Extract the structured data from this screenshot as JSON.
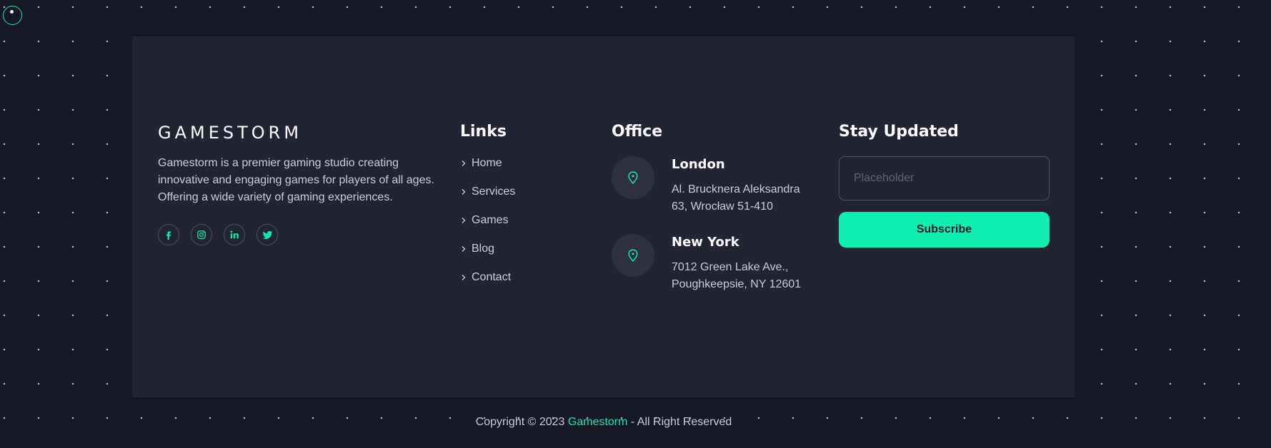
{
  "colors": {
    "page_background": "#161828",
    "panel_background": "#222433",
    "accent": "#10eeb3",
    "heading_text": "#ffffff",
    "body_text": "#c9ccd6"
  },
  "brand": {
    "logo": "GAMESTORM",
    "description": "Gamestorm is a premier gaming studio creating innovative and engaging games for players of all ages. Offering a wide variety of gaming experiences.",
    "socials": [
      {
        "icon": "facebook-icon"
      },
      {
        "icon": "instagram-icon"
      },
      {
        "icon": "linkedin-icon"
      },
      {
        "icon": "twitter-icon"
      }
    ]
  },
  "links": {
    "heading": "Links",
    "items": [
      {
        "label": "Home",
        "icon": "chevron-right-icon"
      },
      {
        "label": "Services",
        "icon": "chevron-right-icon"
      },
      {
        "label": "Games",
        "icon": "chevron-right-icon"
      },
      {
        "label": "Blog",
        "icon": "chevron-right-icon"
      },
      {
        "label": "Contact",
        "icon": "chevron-right-icon"
      }
    ]
  },
  "office": {
    "heading": "Office",
    "locations": [
      {
        "city": "London",
        "address_line1": "Al. Brucknera Aleksandra",
        "address_line2": "63, Wrocław 51-410",
        "icon": "map-pin-icon"
      },
      {
        "city": "New York",
        "address_line1": "7012 Green Lake Ave.,",
        "address_line2": "Poughkeepsie, NY 12601",
        "icon": "map-pin-icon"
      }
    ]
  },
  "newsletter": {
    "heading": "Stay Updated",
    "input_placeholder": "Placeholder",
    "input_value": "",
    "button_label": "Subscribe"
  },
  "footer": {
    "copyright_prefix": "Copyright © 2023 ",
    "brand_link": "Gamestorm",
    "copyright_suffix": " - All Right Reserved"
  }
}
